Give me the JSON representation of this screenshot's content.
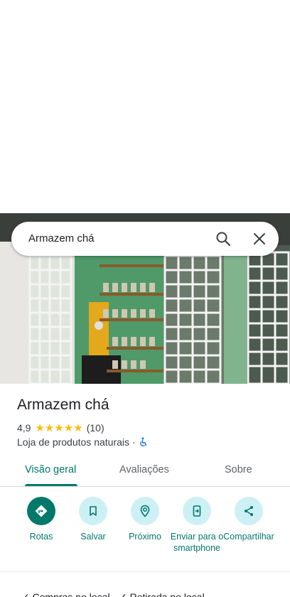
{
  "search": {
    "query": "Armazem chá"
  },
  "place": {
    "name": "Armazem chá",
    "rating": "4,9",
    "stars": 5,
    "reviews": "(10)",
    "category": "Loja de produtos naturais",
    "separator": "·"
  },
  "tabs": [
    {
      "label": "Visão geral",
      "active": true
    },
    {
      "label": "Avaliações",
      "active": false
    },
    {
      "label": "Sobre",
      "active": false
    }
  ],
  "actions": [
    {
      "label": "Rotas",
      "icon": "directions-icon"
    },
    {
      "label": "Salvar",
      "icon": "bookmark-icon"
    },
    {
      "label": "Próximo",
      "icon": "nearby-icon"
    },
    {
      "label": "Enviar para o smartphone",
      "icon": "send-to-phone-icon"
    },
    {
      "label": "Compartilhar",
      "icon": "share-icon"
    }
  ],
  "colors": {
    "accent": "#00796b",
    "action_bg": "#cdf0f5",
    "star": "#fbbc04"
  },
  "bottom": {
    "text": "✓ Compras no local  ·  ✓ Retirada no local"
  }
}
